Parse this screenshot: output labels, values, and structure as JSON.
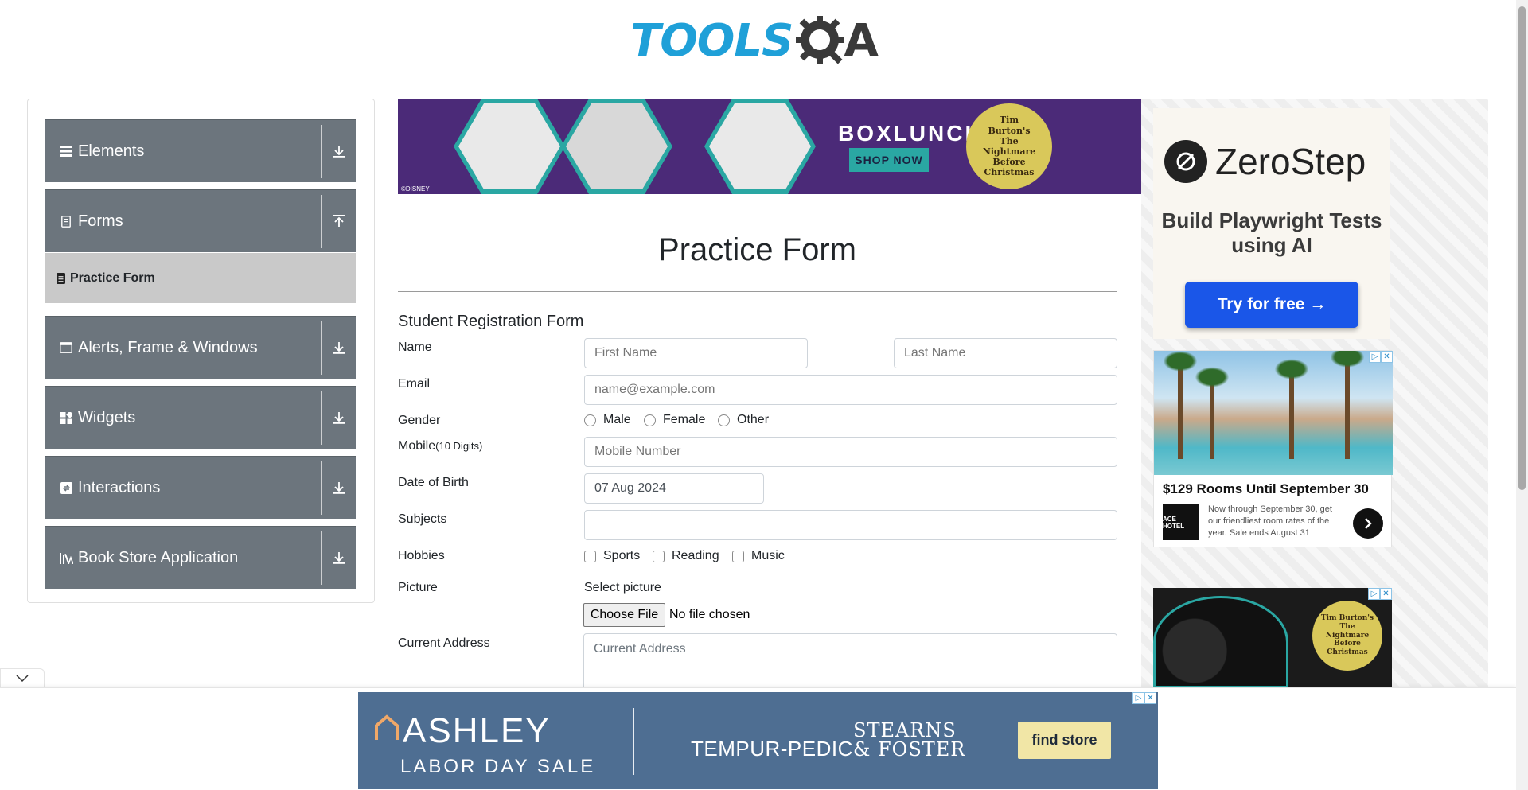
{
  "header": {
    "logo_text_left": "TOOLS",
    "logo_text_right": "A",
    "logo_alt": "ToolsQA"
  },
  "sidebar": {
    "groups": [
      {
        "label": "Elements",
        "icon": "hamburger-icon",
        "toggle": "download-arrow-icon",
        "expanded": false
      },
      {
        "label": "Forms",
        "icon": "document-icon",
        "toggle": "upload-arrow-icon",
        "expanded": true
      },
      {
        "label": "Alerts, Frame & Windows",
        "icon": "window-icon",
        "toggle": "download-arrow-icon",
        "expanded": false
      },
      {
        "label": "Widgets",
        "icon": "widgets-icon",
        "toggle": "download-arrow-icon",
        "expanded": false
      },
      {
        "label": "Interactions",
        "icon": "interactions-icon",
        "toggle": "download-arrow-icon",
        "expanded": false
      },
      {
        "label": "Book Store Application",
        "icon": "library-icon",
        "toggle": "download-arrow-icon",
        "expanded": false
      }
    ],
    "subitems": [
      {
        "label": "Practice Form",
        "icon": "form-icon",
        "active": true
      }
    ]
  },
  "top_ad": {
    "brand": "BOXLUNCH",
    "cta": "SHOP NOW",
    "seal": "Tim Burton's The Nightmare Before Christmas",
    "copyright": "©DISNEY"
  },
  "form": {
    "title": "Practice Form",
    "subtitle": "Student Registration Form",
    "name_label": "Name",
    "first_name_placeholder": "First Name",
    "last_name_placeholder": "Last Name",
    "email_label": "Email",
    "email_placeholder": "name@example.com",
    "gender_label": "Gender",
    "gender_options": [
      "Male",
      "Female",
      "Other"
    ],
    "mobile_label": "Mobile",
    "mobile_hint": "(10 Digits)",
    "mobile_placeholder": "Mobile Number",
    "dob_label": "Date of Birth",
    "dob_value": "07 Aug 2024",
    "subjects_label": "Subjects",
    "subjects_value": "",
    "hobbies_label": "Hobbies",
    "hobby_options": [
      "Sports",
      "Reading",
      "Music"
    ],
    "picture_label": "Picture",
    "select_picture": "Select picture",
    "choose_file": "Choose File",
    "no_file": "No file chosen",
    "address_label": "Current Address",
    "address_placeholder": "Current Address"
  },
  "right_ads": {
    "zerostep": {
      "name": "ZeroStep",
      "tagline": "Build Playwright Tests using AI",
      "cta": "Try for free →"
    },
    "ace": {
      "headline": "$129 Rooms Until September 30",
      "body": "Now through September 30, get our friendliest room rates of the year. Sale ends August 31",
      "logo": "ACE HOTEL"
    },
    "nbc": {
      "seal": "Tim Burton's The Nightmare Before Christmas"
    }
  },
  "bottom_ad": {
    "brand": "ASHLEY",
    "sale": "LABOR DAY SALE",
    "partner1": "TEMPUR-PEDIC",
    "partner2_line1": "STEARNS",
    "partner2_line2": "& FOSTER",
    "cta": "find store"
  },
  "colors": {
    "sidebar_group": "#6c757d",
    "sidebar_active": "#c9c9c9",
    "logo_blue": "#1fa0d8",
    "zerostep_button": "#1a56e8",
    "ashley_bg": "#4e6e92"
  }
}
